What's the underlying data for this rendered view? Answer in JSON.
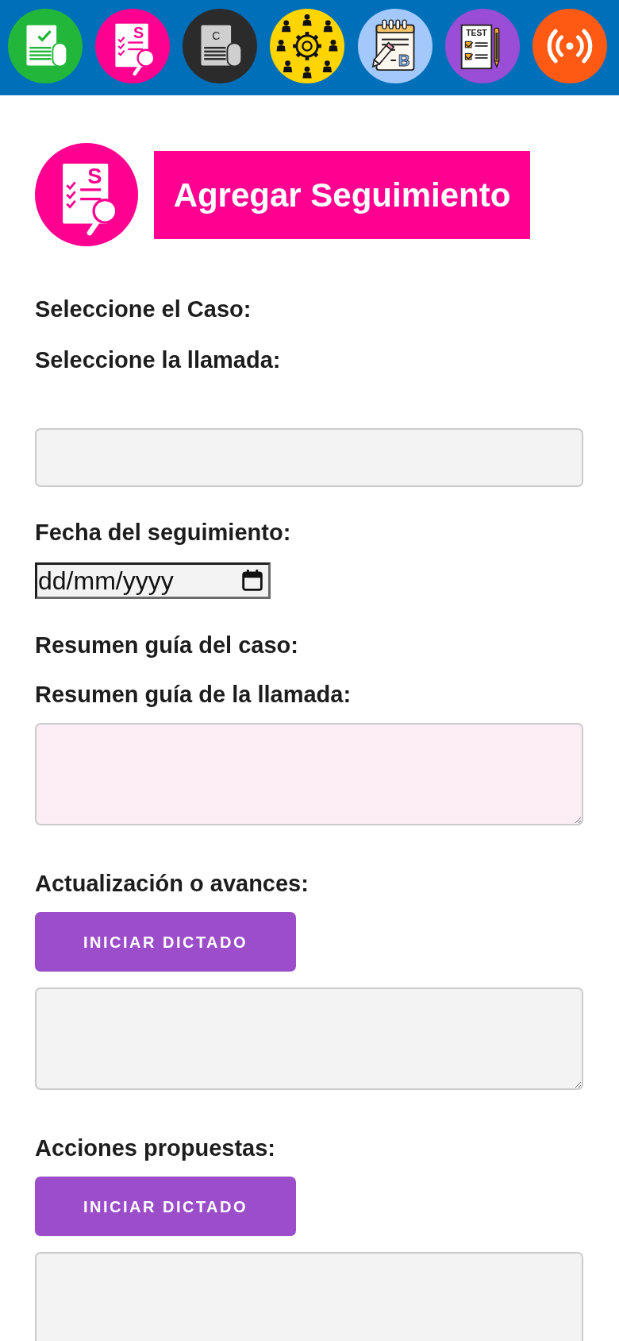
{
  "toolbar": {
    "apps": [
      {
        "kind": "document-check",
        "color": "#22b73a"
      },
      {
        "kind": "checklist-search",
        "color": "#ff0090",
        "icon_text": "S"
      },
      {
        "kind": "document",
        "color": "#2b2b2b",
        "icon_text": "C"
      },
      {
        "kind": "team-gear",
        "color": "#ffd500"
      },
      {
        "kind": "notepad-pencil",
        "color": "#a3c9fa",
        "icon_text": "B"
      },
      {
        "kind": "test-sheet",
        "color": "#9a4dd6",
        "icon_text": "TEST"
      },
      {
        "kind": "broadcast",
        "color": "#ff5a14"
      }
    ]
  },
  "header": {
    "icon": {
      "kind": "checklist-search",
      "color": "#ff0090",
      "icon_text": "S"
    },
    "title": "Agregar Seguimiento"
  },
  "fields": [
    {
      "kind": "heading",
      "label": "Seleccione el Caso:"
    },
    {
      "kind": "heading",
      "label": "Seleccione la llamada:"
    },
    {
      "kind": "input",
      "color": "#f3f3f3"
    },
    {
      "kind": "date",
      "label": "Fecha del seguimiento:",
      "placeholder": "dd/mm/yyyy"
    },
    {
      "kind": "heading",
      "label": "Resumen guía del caso:"
    },
    {
      "kind": "textarea",
      "label": "Resumen guía de la llamada:",
      "color": "#fdeef6"
    },
    {
      "kind": "textarea",
      "label": "Actualización o avances:",
      "button": "INICIAR DICTADO",
      "color": "#f3f3f3"
    },
    {
      "kind": "textarea",
      "label": "Acciones propuestas:",
      "button": "INICIAR DICTADO",
      "color": "#f3f3f3"
    }
  ]
}
